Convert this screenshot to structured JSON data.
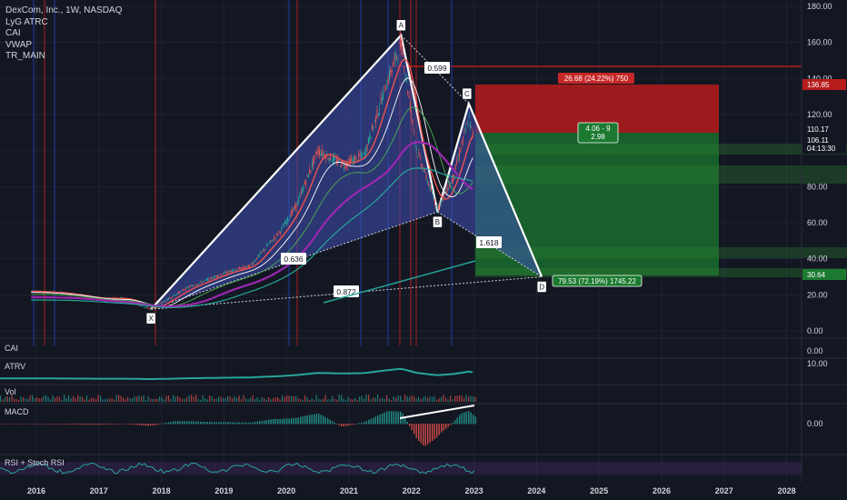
{
  "legend": {
    "title": "DexCom, Inc., 1W, NASDAQ",
    "indicators": [
      "LyG ATRC",
      "CAI",
      "VWAP",
      "TR_MAIN"
    ]
  },
  "panes": {
    "cai": "CAI",
    "atrv": "ATRV",
    "vol": "Vol",
    "macd": "MACD",
    "rsi": "RSI + Stoch RSI"
  },
  "price_axis": {
    "ticks": [
      "180.00",
      "160.00",
      "140.00",
      "120.00",
      "80.00",
      "60.00",
      "40.00",
      "20.00",
      "0.00"
    ],
    "cai_tick": "0.00",
    "atrv_tick": "10.00",
    "macd_tick": "0.00"
  },
  "price_tags": {
    "stop": "136.85",
    "close": "110.17",
    "last": "106.11",
    "countdown": "04:13:30",
    "target": "30.64"
  },
  "position_labels": {
    "risk": "26.68 (24.22%) 750",
    "ratio_line1": "4.06 - 9",
    "ratio_line2": "2.98",
    "reward": "79.53 (72.19%) 1745.22"
  },
  "pattern_points": [
    "X",
    "A",
    "B",
    "C",
    "D"
  ],
  "pattern_ratios": {
    "ab": "0.599",
    "xb": "0.636",
    "bd": "1.618",
    "xd": "0.872"
  },
  "colors": {
    "background": "#131722",
    "pattern_fill": "#3f51b5",
    "stop_zone": "#b71c1c",
    "target_zone": "#1b7a2f",
    "up": "#26a69a",
    "down": "#ef5350",
    "line": "#ffffff"
  },
  "chart_data": {
    "type": "line",
    "title": "DexCom, Inc., 1W, NASDAQ",
    "x_ticks": [
      "2016",
      "2017",
      "2018",
      "2019",
      "2020",
      "2021",
      "2022",
      "2023",
      "2024",
      "2025",
      "2026",
      "2027",
      "2028"
    ],
    "y_range": [
      0,
      180
    ],
    "harmonic_pattern": {
      "points": [
        {
          "label": "X",
          "date": "2017-11",
          "price": 12
        },
        {
          "label": "A",
          "date": "2021-11",
          "price": 164
        },
        {
          "label": "B",
          "date": "2022-06",
          "price": 66
        },
        {
          "label": "C",
          "date": "2022-12",
          "price": 126
        },
        {
          "label": "D",
          "date": "2024-02",
          "price": 30
        }
      ],
      "ratios": {
        "AB": 0.599,
        "XB": 0.636,
        "BD": 1.618,
        "XD": 0.872
      }
    },
    "position": {
      "entry": 110.17,
      "stop": 136.85,
      "target": 30.64,
      "risk": "26.68 (24.22%) 750",
      "reward": "79.53 (72.19%) 1745.22",
      "ratio": "2.98"
    },
    "price_series": {
      "name": "",
      "points": [
        {
          "date": "2015-12",
          "price": 22
        },
        {
          "date": "2016-06",
          "price": 21
        },
        {
          "date": "2017-01",
          "price": 18
        },
        {
          "date": "2017-06",
          "price": 18
        },
        {
          "date": "2017-11",
          "price": 12
        },
        {
          "date": "2018-06",
          "price": 24
        },
        {
          "date": "2019-01",
          "price": 32
        },
        {
          "date": "2019-06",
          "price": 36
        },
        {
          "date": "2019-12",
          "price": 56
        },
        {
          "date": "2020-03",
          "price": 70
        },
        {
          "date": "2020-07",
          "price": 100
        },
        {
          "date": "2020-12",
          "price": 92
        },
        {
          "date": "2021-04",
          "price": 98
        },
        {
          "date": "2021-08",
          "price": 135
        },
        {
          "date": "2021-11",
          "price": 160
        },
        {
          "date": "2022-02",
          "price": 100
        },
        {
          "date": "2022-06",
          "price": 68
        },
        {
          "date": "2022-09",
          "price": 85
        },
        {
          "date": "2022-12",
          "price": 118
        },
        {
          "date": "2023-01",
          "price": 106
        }
      ]
    }
  }
}
